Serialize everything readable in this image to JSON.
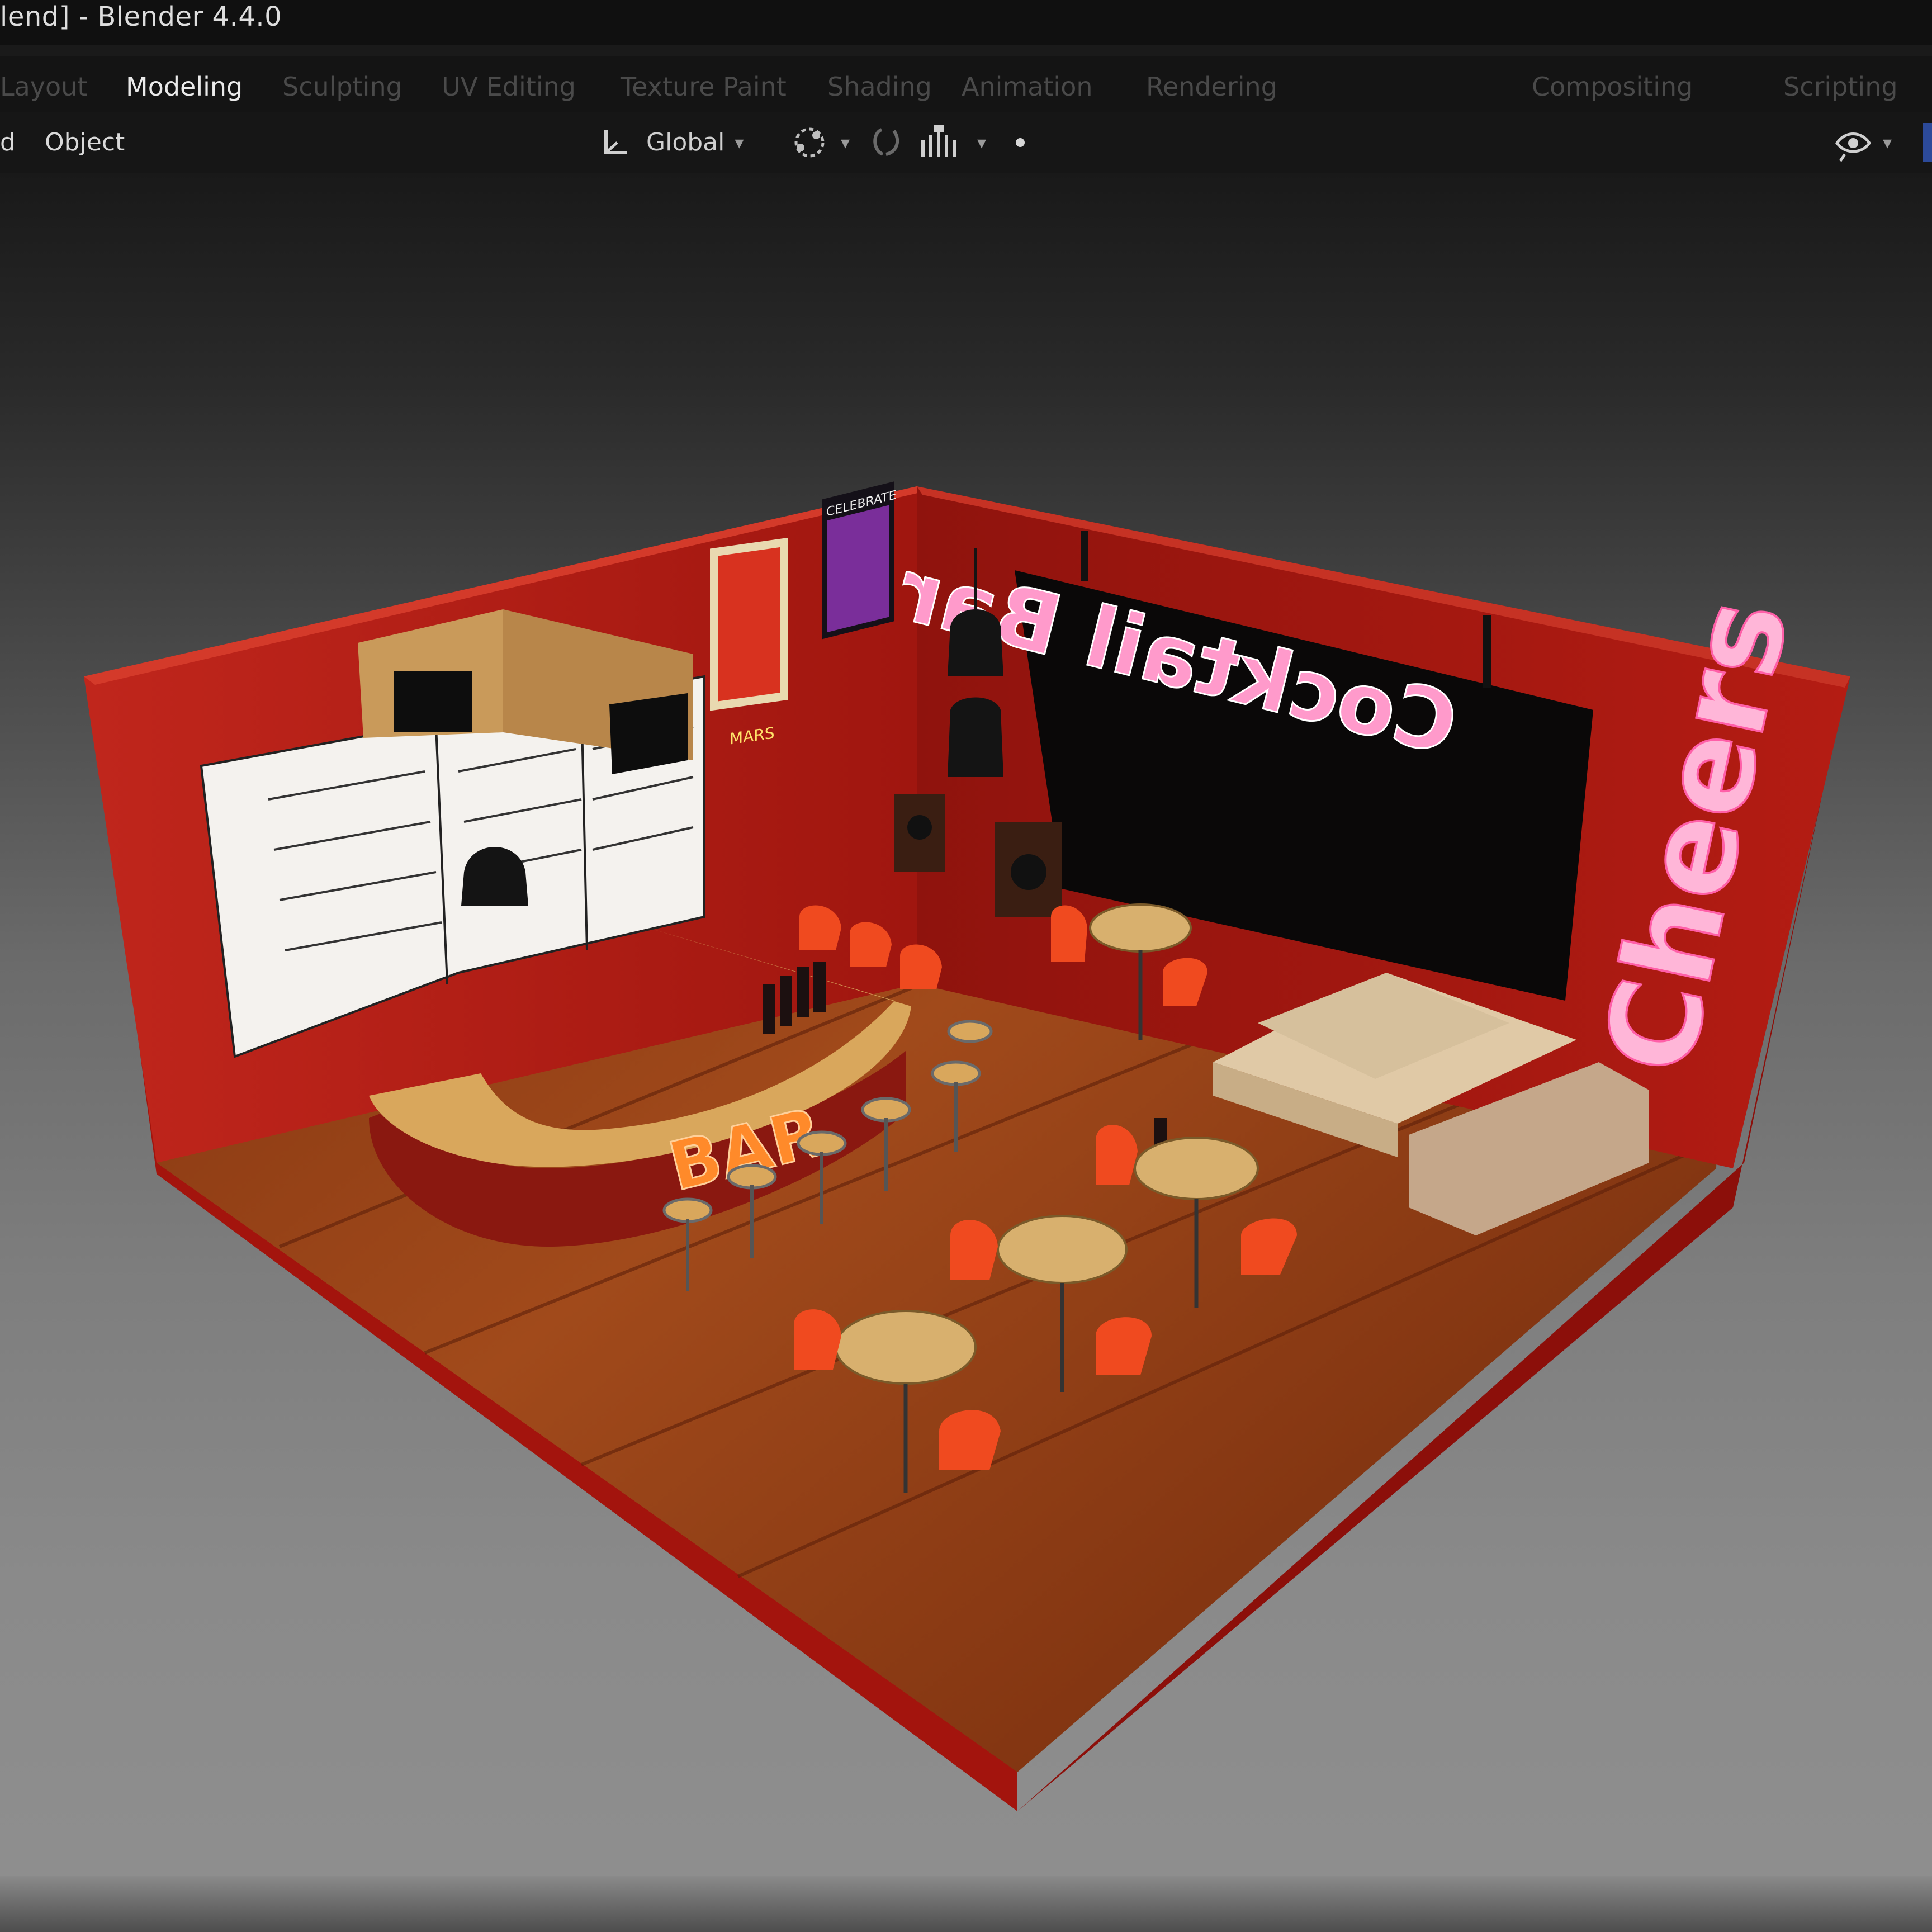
{
  "window": {
    "title": "lend] - Blender 4.4.0"
  },
  "workspace_tabs": [
    {
      "label": "Layout",
      "active": false
    },
    {
      "label": "Modeling",
      "active": true
    },
    {
      "label": "Sculpting",
      "active": false
    },
    {
      "label": "UV Editing",
      "active": false
    },
    {
      "label": "Texture Paint",
      "active": false
    },
    {
      "label": "Shading",
      "active": false
    },
    {
      "label": "Animation",
      "active": false
    },
    {
      "label": "Rendering",
      "active": false
    },
    {
      "label": "Compositing",
      "active": false
    },
    {
      "label": "Scripting",
      "active": false
    }
  ],
  "header": {
    "menu_partial": "d",
    "menu_object": "Object",
    "transform_orientation": "Global"
  },
  "icons": {
    "orientation": "transform-orientation-icon",
    "pivot": "pivot-point-icon",
    "snap": "snap-icon",
    "proportional": "proportional-editing-icon",
    "visibility": "eye-visibility-icon"
  },
  "scene": {
    "sign_back_wall": "Cocktail Bar",
    "sign_side_wall": "Cheers",
    "counter_sign": "BAR",
    "poster_left_text": "MARS",
    "poster_right_text": "CELEBRATE",
    "colors": {
      "wall": "#b01a12",
      "floor": "#8a3d14",
      "counter_top": "#d9a75c",
      "chair": "#f04a1f",
      "table_top": "#d8b06e",
      "neon_pink": "#ff9acb",
      "neon_orange": "#ff8a2a"
    }
  }
}
